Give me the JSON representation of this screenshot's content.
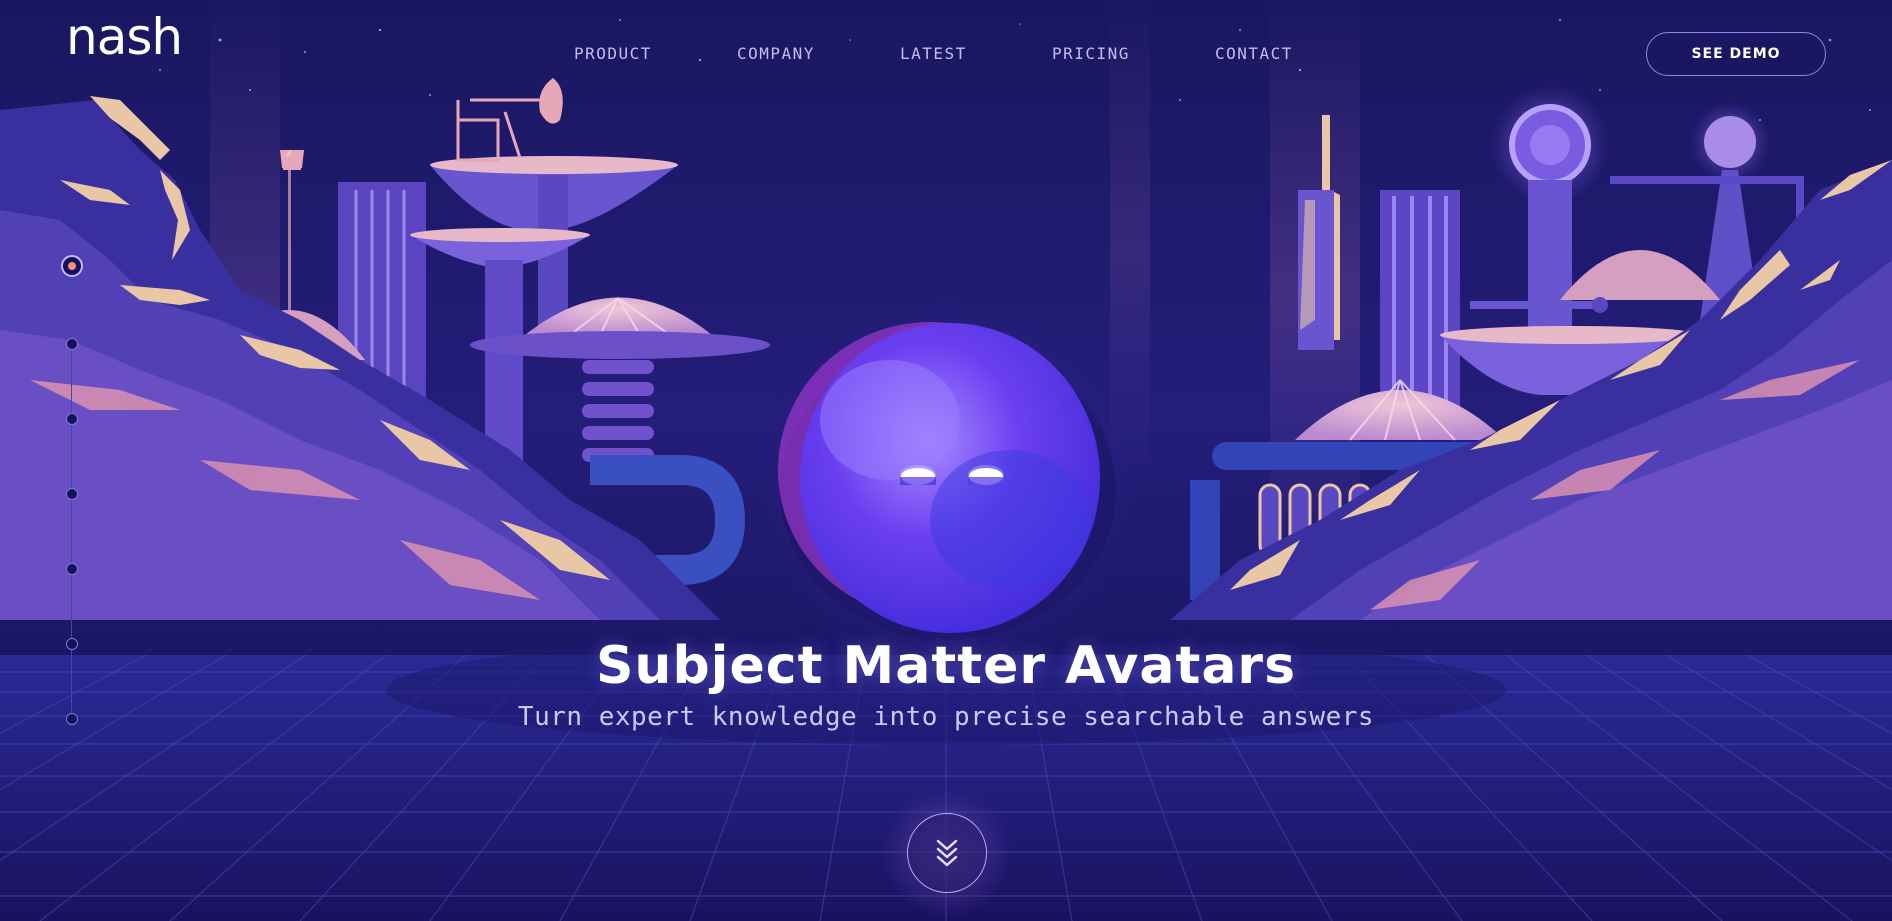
{
  "brand": {
    "logo_text": "nash"
  },
  "nav": {
    "items": [
      {
        "label": "PRODUCT"
      },
      {
        "label": "COMPANY"
      },
      {
        "label": "LATEST"
      },
      {
        "label": "PRICING"
      },
      {
        "label": "CONTACT"
      }
    ]
  },
  "cta": {
    "label": "SEE DEMO"
  },
  "pager": {
    "count": 7,
    "active": 1
  },
  "hero": {
    "title": "Subject Matter Avatars",
    "subtitle": "Turn expert knowledge into precise searchable answers"
  },
  "scroll": {
    "icon": "double-chevron-down-icon"
  },
  "colors": {
    "background": "#14125a",
    "accent": "#7b5cff",
    "rock_highlight": "#e8c9a0",
    "nav_text": "#c3bdf0"
  }
}
